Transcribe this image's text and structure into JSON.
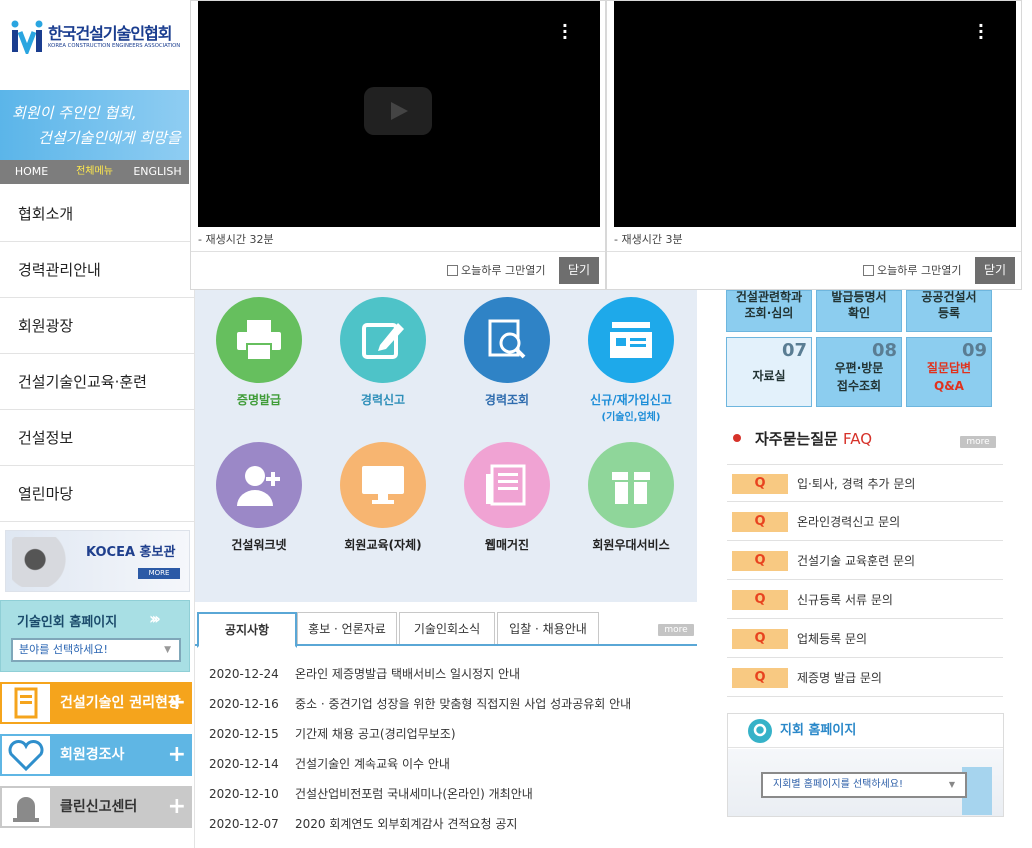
{
  "sidebar": {
    "logo_title": "한국건설기술인협회",
    "logo_sub": "KOREA CONSTRUCTION ENGINEERS ASSOCIATION",
    "slogan_line1": "회원이 주인인 협회,",
    "slogan_line2": "건설기술인에게 희망을",
    "topnav": [
      "HOME",
      "전체메뉴",
      "ENGLISH"
    ],
    "menu": [
      "협회소개",
      "경력관리안내",
      "회원광장",
      "건설기술인교육·훈련",
      "건설정보",
      "열린마당"
    ],
    "kocea": {
      "title": "KOCEA 홍보관",
      "more": "MORE"
    },
    "homepage": {
      "title": "기술인회 홈페이지",
      "select_placeholder": "분야를 선택하세요!"
    },
    "buttons": [
      {
        "label": "건설기술인 권리현장",
        "color": "#f5a41c",
        "plus": "+"
      },
      {
        "label": "회원경조사",
        "color": "#5fb6e4",
        "plus": "+"
      },
      {
        "label": "클린신고센터",
        "color": "#c9c9c9",
        "plus": "+"
      }
    ]
  },
  "videos": [
    {
      "duration": "- 재생시간 32분",
      "checkbox": "오늘하루 그만열기",
      "close": "닫기"
    },
    {
      "duration": "- 재생시간 3분",
      "checkbox": "오늘하루 그만열기",
      "close": "닫기"
    }
  ],
  "quick_icons": [
    {
      "label": "증명발급",
      "color": "#66bf5e",
      "label_color": "#3f9c38"
    },
    {
      "label": "경력신고",
      "color": "#4ec3c8",
      "label_color": "#2e8fb9"
    },
    {
      "label": "경력조회",
      "color": "#2f83c6",
      "label_color": "#2e6cae"
    },
    {
      "label": "신규/재가입신고",
      "sub": "(기술인,업체)",
      "color": "#1ea9ea",
      "label_color": "#1e8ed8"
    },
    {
      "label": "건설워크넷",
      "color": "#9b88c7",
      "label_color": "#222"
    },
    {
      "label": "회원교육(자체)",
      "color": "#f7b571",
      "label_color": "#222"
    },
    {
      "label": "웹매거진",
      "color": "#f0a3d3",
      "label_color": "#222"
    },
    {
      "label": "회원우대서비스",
      "color": "#8fd69a",
      "label_color": "#222"
    }
  ],
  "tabs": [
    "공지사항",
    "홍보 · 언론자료",
    "기술인회소식",
    "입찰 · 채용안내"
  ],
  "more": "more",
  "notices": [
    {
      "date": "2020-12-24",
      "title": "온라인 제증명발급 택배서비스 일시정지 안내"
    },
    {
      "date": "2020-12-16",
      "title": "중소 · 중견기업 성장을 위한 맞춤형 직접지원 사업 성과공유회 안내"
    },
    {
      "date": "2020-12-15",
      "title": "기간제 채용 공고(경리업무보조)"
    },
    {
      "date": "2020-12-14",
      "title": "건설기술인 계속교육 이수 안내"
    },
    {
      "date": "2020-12-10",
      "title": "건설산업비전포럼 국내세미나(온라인) 개최안내"
    },
    {
      "date": "2020-12-07",
      "title": "2020 회계연도 외부회계감사 견적요청 공지"
    }
  ],
  "quick_boxes_top": [
    {
      "label1": "건설관련학과",
      "label2": "조회·심의"
    },
    {
      "label1": "발급등명서",
      "label2": "확인"
    },
    {
      "label1": "공공건설서",
      "label2": "등록"
    }
  ],
  "quick_boxes": [
    {
      "num": "07",
      "label1": "자료실",
      "label2": "",
      "bg": "#e3f1fb"
    },
    {
      "num": "08",
      "label1": "우편·방문",
      "label2": "접수조회",
      "bg": "#8ccdef"
    },
    {
      "num": "09",
      "label1": "질문답변",
      "label2": "Q&A",
      "bg": "#8ccdef",
      "text_color": "#e0321e"
    }
  ],
  "faq": {
    "title_ko": "자주묻는질문",
    "title_en": "FAQ",
    "more": "more",
    "q": "Q",
    "items": [
      "입·퇴사, 경력 추가 문의",
      "온라인경력신고 문의",
      "건설기술 교육훈련 문의",
      "신규등록 서류 문의",
      "업체등록 문의",
      "제증명 발급 문의"
    ]
  },
  "branch": {
    "title": "지회 홈페이지",
    "select_placeholder": "지회별 홈페이지를 선택하세요!"
  }
}
